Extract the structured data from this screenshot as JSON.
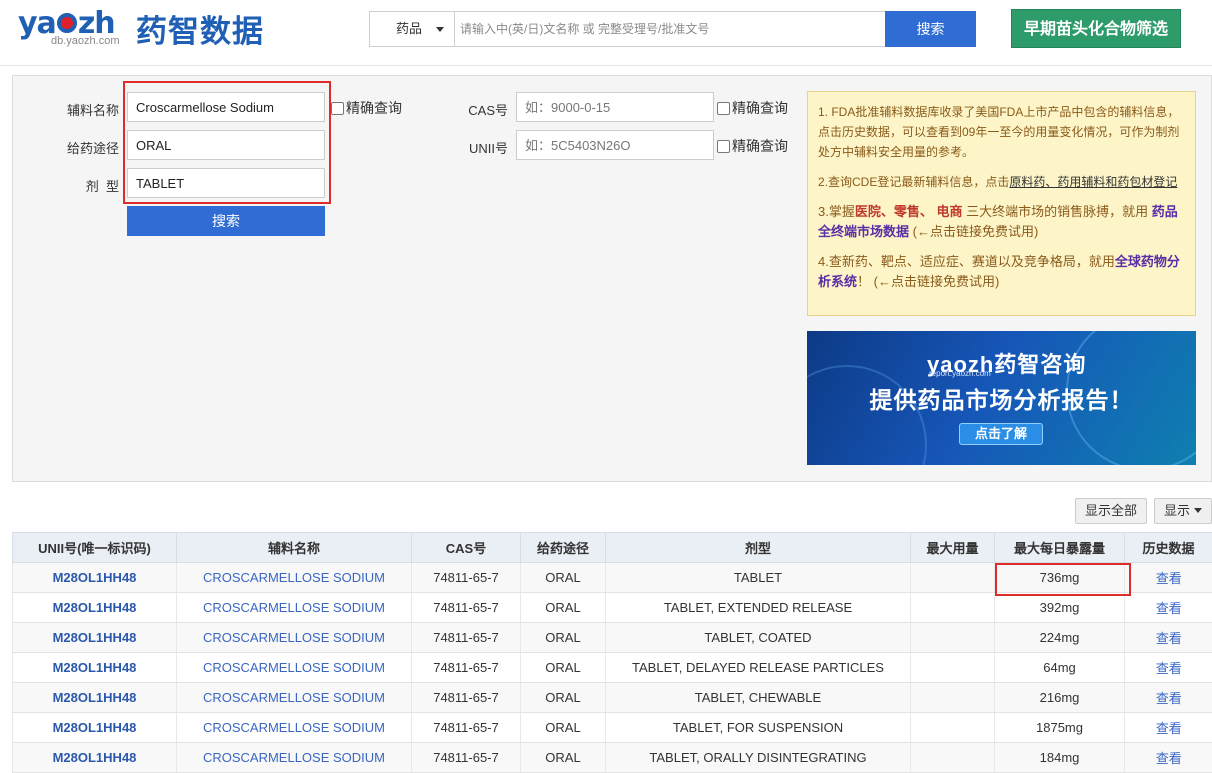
{
  "header": {
    "logo_text": "yaozh",
    "logo_cn": "药智数据",
    "logo_sub": "db.yaozh.com",
    "search_type": "药品",
    "search_placeholder": "请输入中(英/日)文名称 或 完整受理号/批准文号",
    "search_button": "搜索",
    "screen_button": "早期苗头化合物筛选"
  },
  "filters": {
    "excipient_label": "辅料名称",
    "excipient_value": "Croscarmellose Sodium",
    "route_label": "给药途径",
    "route_value": "ORAL",
    "dosage_label": "剂  型",
    "dosage_value": "TABLET",
    "exact_label": "精确查询",
    "search_button": "搜索",
    "cas_label": "CAS号",
    "cas_placeholder": "如：9000-0-15",
    "unii_label": "UNII号",
    "unii_placeholder": "如：5C5403N26O"
  },
  "notice": {
    "p1": "1. FDA批准辅料数据库收录了美国FDA上市产品中包含的辅料信息，点击历史数据，可以查看到09年一至今的用量变化情况，可作为制剂处方中辅料安全用量的参考。",
    "p2_pre": "2.查询CDE登记最新辅料信息，点击",
    "p2_link": "原料药、药用辅料和药包材登记",
    "p3_pre": "3.掌握",
    "p3_bold": "医院、零售、 电商",
    "p3_mid": " 三大终端市场的销售脉搏，就用 ",
    "p3_link": "药品全终端市场数据",
    "p3_post": " (←点击链接免费试用)",
    "p4_pre": "4.查新药、靶点、适应症、赛道以及竞争格局，就用",
    "p4_link": "全球药物分析系统",
    "p4_post": "！ (←点击链接免费试用)"
  },
  "banner": {
    "logo": "yaozh药智咨询",
    "sub": "report.yaozh.com",
    "title": "提供药品市场分析报告！",
    "button": "点击了解"
  },
  "toolbar": {
    "show_all": "显示全部",
    "show": "显示"
  },
  "table": {
    "headers": [
      "UNII号(唯一标识码)",
      "辅料名称",
      "CAS号",
      "给药途径",
      "剂型",
      "最大用量",
      "最大每日暴露量",
      "历史数据"
    ],
    "rows": [
      {
        "unii": "M28OL1HH48",
        "name": "CROSCARMELLOSE SODIUM",
        "cas": "74811-65-7",
        "route": "ORAL",
        "form": "TABLET",
        "max": "",
        "daily": "736mg",
        "history": "查看"
      },
      {
        "unii": "M28OL1HH48",
        "name": "CROSCARMELLOSE SODIUM",
        "cas": "74811-65-7",
        "route": "ORAL",
        "form": "TABLET, EXTENDED RELEASE",
        "max": "",
        "daily": "392mg",
        "history": "查看"
      },
      {
        "unii": "M28OL1HH48",
        "name": "CROSCARMELLOSE SODIUM",
        "cas": "74811-65-7",
        "route": "ORAL",
        "form": "TABLET, COATED",
        "max": "",
        "daily": "224mg",
        "history": "查看"
      },
      {
        "unii": "M28OL1HH48",
        "name": "CROSCARMELLOSE SODIUM",
        "cas": "74811-65-7",
        "route": "ORAL",
        "form": "TABLET, DELAYED RELEASE PARTICLES",
        "max": "",
        "daily": "64mg",
        "history": "查看"
      },
      {
        "unii": "M28OL1HH48",
        "name": "CROSCARMELLOSE SODIUM",
        "cas": "74811-65-7",
        "route": "ORAL",
        "form": "TABLET, CHEWABLE",
        "max": "",
        "daily": "216mg",
        "history": "查看"
      },
      {
        "unii": "M28OL1HH48",
        "name": "CROSCARMELLOSE SODIUM",
        "cas": "74811-65-7",
        "route": "ORAL",
        "form": "TABLET, FOR SUSPENSION",
        "max": "",
        "daily": "1875mg",
        "history": "查看"
      },
      {
        "unii": "M28OL1HH48",
        "name": "CROSCARMELLOSE SODIUM",
        "cas": "74811-65-7",
        "route": "ORAL",
        "form": "TABLET, ORALLY DISINTEGRATING",
        "max": "",
        "daily": "184mg",
        "history": "查看"
      }
    ]
  }
}
